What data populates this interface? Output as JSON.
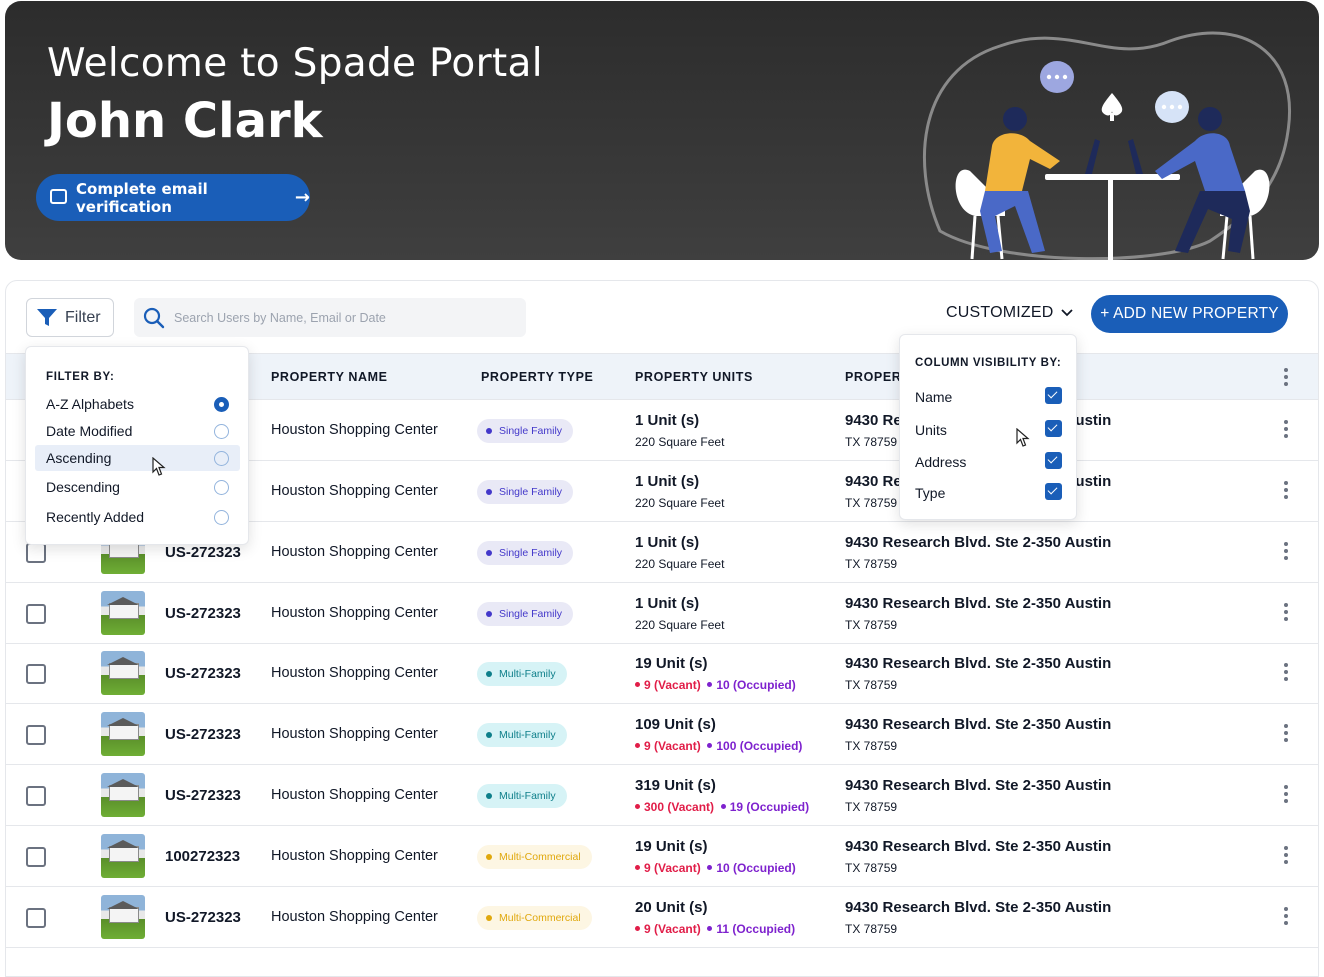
{
  "banner": {
    "welcome": "Welcome to Spade Portal",
    "user_name": "John Clark",
    "verify_label": "Complete email verification",
    "verify_arrow": "→"
  },
  "toolbar": {
    "filter_label": "Filter",
    "search_placeholder": "Search Users by Name, Email or Date",
    "customized_label": "CUSTOMIZED",
    "add_label": "+ ADD NEW PROPERTY"
  },
  "table": {
    "headers": {
      "name": "PROPERTY NAME",
      "type": "PROPERTY TYPE",
      "units": "PROPERTY UNITS",
      "address": "PROPERT"
    },
    "rows": [
      {
        "id": "",
        "name": "Houston Shopping Center",
        "type": "Single Family",
        "units": "1 Unit (s)",
        "sqft": "220 Square Feet",
        "vacant": "",
        "occupied": "",
        "address": "9430 Research Blvd. Ste 2-350 Austin",
        "zip": "TX 78759"
      },
      {
        "id": "",
        "name": "Houston Shopping Center",
        "type": "Single Family",
        "units": "1 Unit (s)",
        "sqft": "220 Square Feet",
        "vacant": "",
        "occupied": "",
        "address": "9430 Research Blvd. Ste 2-350 Austin",
        "zip": "TX 78759"
      },
      {
        "id": "US-272323",
        "name": "Houston Shopping Center",
        "type": "Single Family",
        "units": "1 Unit (s)",
        "sqft": "220 Square Feet",
        "vacant": "",
        "occupied": "",
        "address": "9430 Research Blvd. Ste 2-350 Austin",
        "zip": "TX 78759"
      },
      {
        "id": "US-272323",
        "name": "Houston Shopping Center",
        "type": "Single Family",
        "units": "1 Unit (s)",
        "sqft": "220 Square Feet",
        "vacant": "",
        "occupied": "",
        "address": "9430 Research Blvd. Ste 2-350 Austin",
        "zip": "TX 78759"
      },
      {
        "id": "US-272323",
        "name": "Houston Shopping Center",
        "type": "Multi-Family",
        "units": "19 Unit (s)",
        "sqft": "",
        "vacant": "9 (Vacant)",
        "occupied": "10 (Occupied)",
        "address": "9430 Research Blvd. Ste 2-350 Austin",
        "zip": "TX 78759"
      },
      {
        "id": "US-272323",
        "name": "Houston Shopping Center",
        "type": "Multi-Family",
        "units": "109 Unit (s)",
        "sqft": "",
        "vacant": "9 (Vacant)",
        "occupied": "100 (Occupied)",
        "address": "9430 Research Blvd. Ste 2-350 Austin",
        "zip": "TX 78759"
      },
      {
        "id": "US-272323",
        "name": "Houston Shopping Center",
        "type": "Multi-Family",
        "units": "319 Unit (s)",
        "sqft": "",
        "vacant": "300 (Vacant)",
        "occupied": "19 (Occupied)",
        "address": "9430 Research Blvd. Ste 2-350 Austin",
        "zip": "TX 78759"
      },
      {
        "id": "100272323",
        "name": "Houston Shopping Center",
        "type": "Multi-Commercial",
        "units": "19 Unit (s)",
        "sqft": "",
        "vacant": "9 (Vacant)",
        "occupied": "10 (Occupied)",
        "address": "9430 Research Blvd. Ste 2-350 Austin",
        "zip": "TX 78759"
      },
      {
        "id": "US-272323",
        "name": "Houston Shopping Center",
        "type": "Multi-Commercial",
        "units": "20 Unit (s)",
        "sqft": "",
        "vacant": "9 (Vacant)",
        "occupied": "11 (Occupied)",
        "address": "9430 Research Blvd. Ste 2-350 Austin",
        "zip": "TX 78759"
      }
    ]
  },
  "filter_menu": {
    "title": "FILTER BY:",
    "options": [
      {
        "label": "A-Z Alphabets",
        "selected": true
      },
      {
        "label": "Date Modified",
        "selected": false
      },
      {
        "label": "Ascending",
        "selected": false
      },
      {
        "label": "Descending",
        "selected": false
      },
      {
        "label": "Recently Added",
        "selected": false
      }
    ],
    "highlighted": "Ascending"
  },
  "column_menu": {
    "title": "COLUMN VISIBILITY BY:",
    "options": [
      {
        "label": "Name",
        "checked": true
      },
      {
        "label": "Units",
        "checked": true
      },
      {
        "label": "Address",
        "checked": true
      },
      {
        "label": "Type",
        "checked": true
      }
    ]
  },
  "colors": {
    "primary": "#1a5eb8",
    "vacant": "#e11d48",
    "occupied": "#7e22ce",
    "banner_bg": "#333333"
  }
}
